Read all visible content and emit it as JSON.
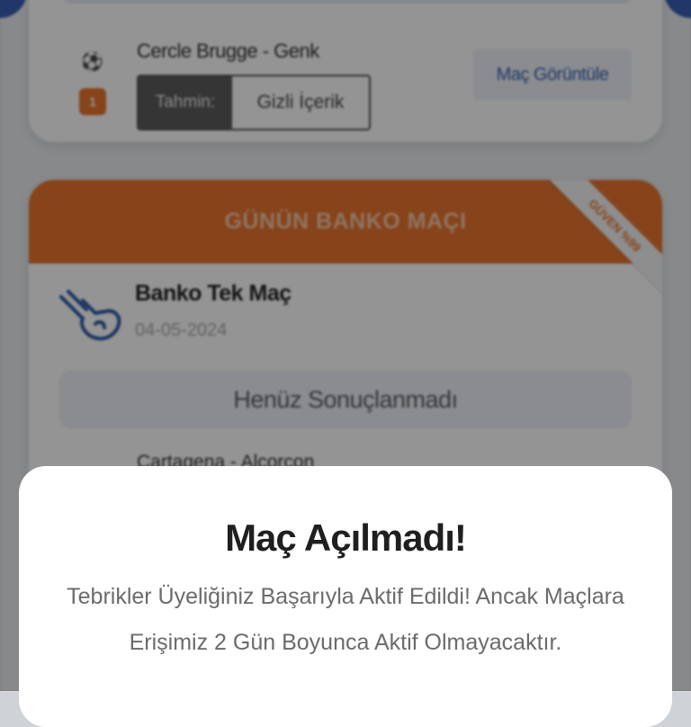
{
  "background": {
    "match_card": {
      "sport_icon": "soccer-ball-icon",
      "badge_number": "1",
      "match_name": "Cercle Brugge - Genk",
      "prediction_label": "Tahmin:",
      "prediction_value": "Gizli İçerik",
      "view_button": "Maç Görüntüle"
    },
    "banko_card": {
      "header": "GÜNÜN BANKO MAÇI",
      "ribbon": "GÜVEN %99",
      "icon": "hand-pointing-icon",
      "title": "Banko Tek Maç",
      "date": "04-05-2024",
      "status": "Henüz Sonuçlanmadı",
      "next_match": "Cartagena - Alcorcon"
    }
  },
  "modal": {
    "title": "Maç Açılmadı!",
    "message": "Tebrikler Üyeliğiniz Başarıyla Aktif Edildi! Ancak Maçlara Erişimiz 2 Gün Boyunca Aktif Olmayacaktır."
  },
  "colors": {
    "accent_orange": "#e8742c",
    "link_blue": "#3a62b3",
    "overlay": "rgba(0,0,0,0.42)"
  }
}
